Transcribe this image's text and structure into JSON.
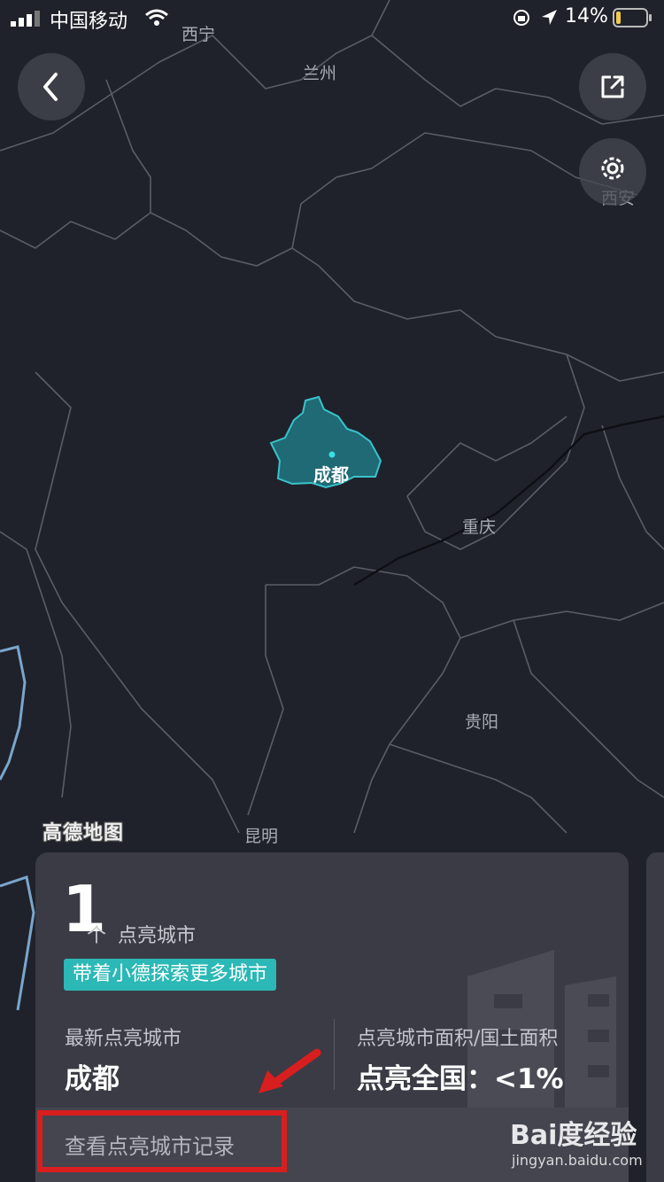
{
  "status_bar": {
    "carrier": "中国移动",
    "battery_text": "14%",
    "icons": [
      "signal-icon",
      "wifi-icon",
      "orientation-lock-icon",
      "location-arrow-icon",
      "battery-icon"
    ]
  },
  "map": {
    "provider_logo": "高德地图",
    "cities": {
      "xining": "西宁",
      "lanzhou": "兰州",
      "xian": "西安",
      "chengdu": "成都",
      "chongqing": "重庆",
      "guiyang": "贵阳",
      "kunming": "昆明"
    },
    "colors": {
      "background": "#1f222b",
      "boundary": "#5a5d68",
      "lit_fill": "#1f6a74",
      "lit_stroke": "#39c3cc",
      "neighbor_border": "#7aa6cc"
    }
  },
  "controls": {
    "back": "back-chevron-icon",
    "share": "share-icon",
    "settings": "gear-icon"
  },
  "card": {
    "lit_count": "1",
    "lit_unit": "个",
    "lit_desc": "点亮城市",
    "explore_badge": "带着小德探索更多城市",
    "latest_label": "最新点亮城市",
    "latest_value": "成都",
    "ratio_label": "点亮城市面积/国土面积",
    "ratio_value": "点亮全国：<1%",
    "record_link": "查看点亮城市记录",
    "accent_color": "#2bb8b6"
  },
  "watermark": {
    "main": "Bai度经验",
    "sub": "jingyan.baidu.com"
  }
}
